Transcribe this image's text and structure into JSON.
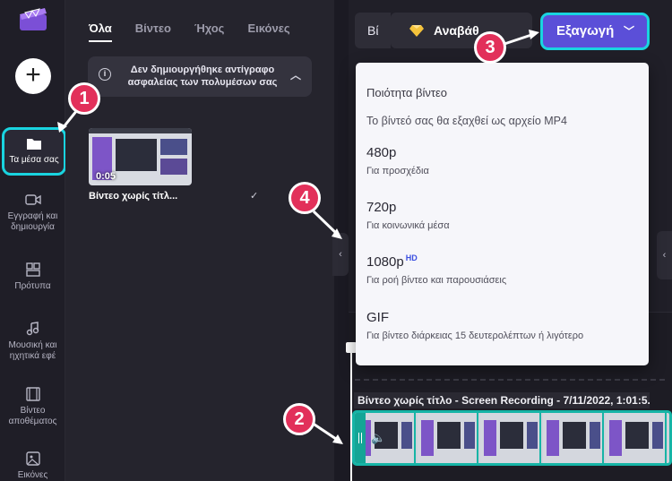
{
  "rail": {
    "items": [
      {
        "label": "Τα μέσα σας"
      },
      {
        "label": "Εγγραφή και δημιουργία"
      },
      {
        "label": "Πρότυπα"
      },
      {
        "label": "Μουσική και ηχητικά εφέ"
      },
      {
        "label": "Βίντεο αποθέματος"
      },
      {
        "label": "Εικόνες"
      }
    ]
  },
  "media": {
    "tabs": [
      "Όλα",
      "Βίντεο",
      "Ήχος",
      "Εικόνες"
    ],
    "backup_notice": "Δεν δημιουργήθηκε αντίγραφο ασφαλείας των πολυμέσων σας",
    "thumb": {
      "duration": "0:05",
      "label": "Βίντεο χωρίς τίτλ..."
    }
  },
  "header": {
    "project_name": "Βί",
    "upgrade_label": "Αναβάθ",
    "export_label": "Εξαγωγή"
  },
  "dropdown": {
    "title": "Ποιότητα βίντεο",
    "subtitle": "Το βίντεό σας θα εξαχθεί ως αρχείο MP4",
    "options": [
      {
        "name": "480p",
        "desc": "Για προσχέδια"
      },
      {
        "name": "720p",
        "desc": "Για κοινωνικά μέσα"
      },
      {
        "name": "1080p",
        "badge": "HD",
        "desc": "Για ροή βίντεο και παρουσιάσεις"
      },
      {
        "name": "GIF",
        "desc": "Για βίντεο διάρκειας 15 δευτερολέπτων ή λιγότερο"
      }
    ]
  },
  "timeline": {
    "clip_label": "Βίντεο χωρίς τίτλο - Screen Recording - 7/11/2022, 1:01:5..."
  },
  "callouts": [
    "1",
    "2",
    "3",
    "4"
  ],
  "colors": {
    "accent_cyan": "#19d4e0",
    "export_purple": "#5b4fd8",
    "badge_red": "#e2305a",
    "clip_teal": "#16b4a6"
  }
}
